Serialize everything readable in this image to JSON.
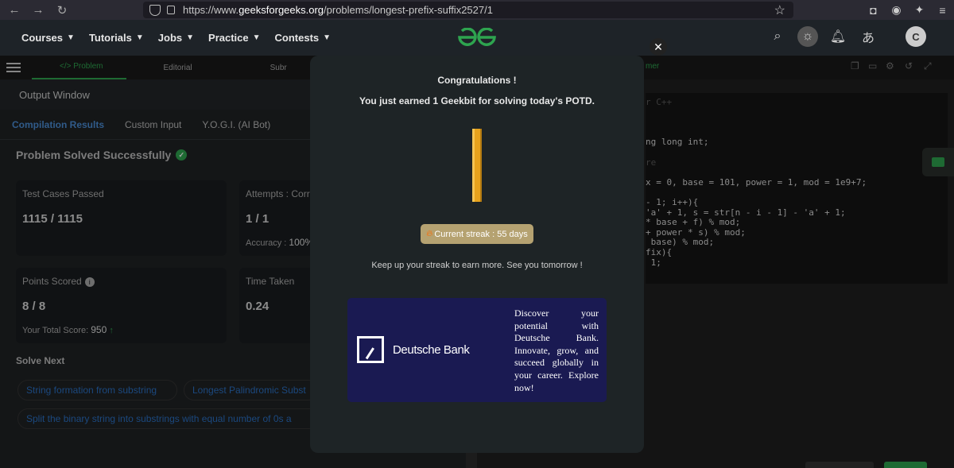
{
  "browser": {
    "url_prefix": "https://www.",
    "url_host": "geeksforgeeks.org",
    "url_path": "/problems/longest-prefix-suffix2527/1"
  },
  "nav": {
    "menu": [
      "Courses",
      "Tutorials",
      "Jobs",
      "Practice",
      "Contests"
    ],
    "avatar_letter": "C"
  },
  "left": {
    "tabs": {
      "problem": "</>  Problem",
      "editorial": "Editorial",
      "submissions": "Subr"
    },
    "output_title": "Output Window",
    "subtabs": [
      "Compilation Results",
      "Custom Input",
      "Y.O.G.I. (AI Bot)"
    ],
    "solved_text": "Problem Solved Successfully",
    "cards": {
      "test_cases_label": "Test Cases Passed",
      "test_cases_value": "1115 / 1115",
      "attempts_label": "Attempts : Corre",
      "attempts_value": "1 / 1",
      "accuracy_label": "Accuracy :",
      "accuracy_value": "100%",
      "points_label": "Points Scored",
      "points_value": "8 / 8",
      "total_score_label": "Your Total Score:",
      "total_score_value": "950",
      "time_label": "Time Taken",
      "time_value": "0.24"
    },
    "solve_next": "Solve Next",
    "chips": [
      "String formation from substring",
      "Longest Palindromic Subst",
      "Split the binary string into substrings with equal number of 0s a"
    ]
  },
  "editor": {
    "lang_hint": "r C++",
    "customize": "mer",
    "lines": [
      "ng long int;",
      "re",
      "x = 0, base = 101, power = 1, mod = 1e9+7;",
      "- 1; i++){",
      "'a' + 1, s = str[n - i - 1] - 'a' + 1;",
      "* base + f) % mod;",
      "+ power * s) % mod;",
      " base) % mod;",
      "fix){",
      " 1;"
    ]
  },
  "modal": {
    "title": "Congratulations !",
    "subtitle": "You just earned 1 Geekbit for solving today's POTD.",
    "streak": "Current streak : 55 days",
    "keep_up": "Keep up your streak to earn more. See you tomorrow !",
    "ad_brand": "Deutsche Bank",
    "ad_text": "Discover your potential with Deutsche Bank. Innovate, grow, and succeed globally in your career. Explore now!"
  },
  "colors": {
    "accent_green": "#2ea44f",
    "link_blue": "#2a6fc2",
    "ad_bg": "#1a1a52",
    "streak_bg": "#b5a271",
    "coin": "#e6a21d"
  }
}
